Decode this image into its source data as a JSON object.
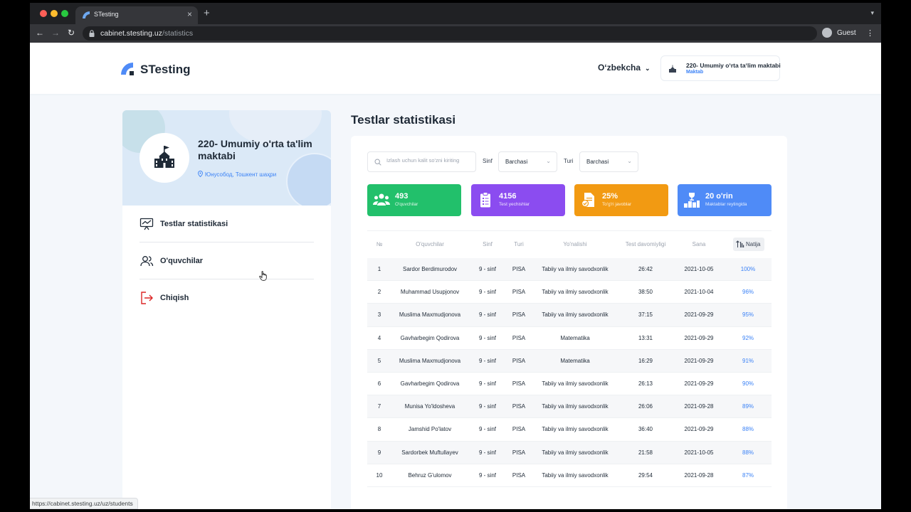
{
  "browser": {
    "tab_title": "STesting",
    "url_host": "cabinet.stesting.uz",
    "url_path": "/statistics",
    "profile_label": "Guest",
    "status_url": "https://cabinet.stesting.uz/uz/students"
  },
  "header": {
    "brand": "STesting",
    "language": "O‘zbekcha",
    "school_name": "220- Umumiy o‘rta ta‘lim maktabi",
    "school_type": "Maktab"
  },
  "sidebar": {
    "school_name": "220- Umumiy o'rta ta'lim maktabi",
    "location": "Юнусобод, Тошкент шаҳри",
    "items": [
      {
        "label": "Testlar statistikasi"
      },
      {
        "label": "O'quvchilar"
      },
      {
        "label": "Chiqish"
      }
    ]
  },
  "main": {
    "title": "Testlar statistikasi",
    "search_placeholder": "Izlash uchun kalit so'zni kiriting",
    "filters": [
      {
        "label": "Sinf",
        "value": "Barchasi"
      },
      {
        "label": "Turi",
        "value": "Barchasi"
      }
    ],
    "stats": [
      {
        "value": "493",
        "label": "O'quvchilar",
        "color": "#22c06b",
        "icon": "students-icon"
      },
      {
        "value": "4156",
        "label": "Test yechishlar",
        "color": "#8b4cf0",
        "icon": "clipboard-icon"
      },
      {
        "value": "25%",
        "label": "To'g'ri javoblar",
        "color": "#f29a12",
        "icon": "correct-document-icon"
      },
      {
        "value": "20 o'rin",
        "label": "Maktablar reytingida",
        "color": "#4f8bf7",
        "icon": "ranking-icon"
      }
    ],
    "table": {
      "headers": [
        "№",
        "O'quvchilar",
        "Sinf",
        "Turi",
        "Yo'nalishi",
        "Test davomiyligi",
        "Sana",
        "Natija"
      ],
      "rows": [
        [
          "1",
          "Sardor Berdimurodov",
          "9 - sinf",
          "PISA",
          "Tabiiy va ilmiy savodxonlik",
          "26:42",
          "2021-10-05",
          "100%"
        ],
        [
          "2",
          "Muhammad Usupjonov",
          "9 - sinf",
          "PISA",
          "Tabiiy va ilmiy savodxonlik",
          "38:50",
          "2021-10-04",
          "96%"
        ],
        [
          "3",
          "Muslima Maxmudjonova",
          "9 - sinf",
          "PISA",
          "Tabiiy va ilmiy savodxonlik",
          "37:15",
          "2021-09-29",
          "95%"
        ],
        [
          "4",
          "Gavharbegim Qodirova",
          "9 - sinf",
          "PISA",
          "Matematika",
          "13:31",
          "2021-09-29",
          "92%"
        ],
        [
          "5",
          "Muslima Maxmudjonova",
          "9 - sinf",
          "PISA",
          "Matematika",
          "16:29",
          "2021-09-29",
          "91%"
        ],
        [
          "6",
          "Gavharbegim Qodirova",
          "9 - sinf",
          "PISA",
          "Tabiiy va ilmiy savodxonlik",
          "26:13",
          "2021-09-29",
          "90%"
        ],
        [
          "7",
          "Munisa Yo'ldosheva",
          "9 - sinf",
          "PISA",
          "Tabiiy va ilmiy savodxonlik",
          "26:06",
          "2021-09-28",
          "89%"
        ],
        [
          "8",
          "Jamshid Po'latov",
          "9 - sinf",
          "PISA",
          "Tabiiy va ilmiy savodxonlik",
          "36:40",
          "2021-09-29",
          "88%"
        ],
        [
          "9",
          "Sardorbek Muftullayev",
          "9 - sinf",
          "PISA",
          "Tabiiy va ilmiy savodxonlik",
          "21:58",
          "2021-10-05",
          "88%"
        ],
        [
          "10",
          "Behruz G'ulomov",
          "9 - sinf",
          "PISA",
          "Tabiiy va ilmiy savodxonlik",
          "29:54",
          "2021-09-28",
          "87%"
        ]
      ]
    }
  }
}
